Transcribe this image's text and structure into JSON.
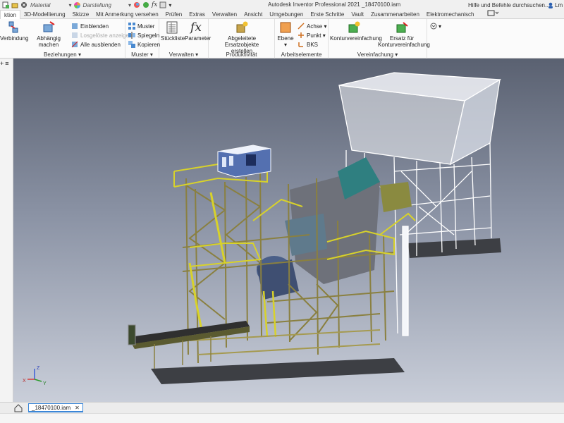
{
  "title_bar": {
    "app_title": "Autodesk Inventor Professional 2021   _18470100.iam",
    "material_combo": "Material",
    "appearance_combo": "Darstellung",
    "help_search": "Hilfe und Befehle durchsuchen...",
    "user_label": "Lm"
  },
  "ribbon_tabs": [
    "ktion",
    "3D-Modellierung",
    "Skizze",
    "Mit Anmerkung versehen",
    "Prüfen",
    "Extras",
    "Verwalten",
    "Ansicht",
    "Umgebungen",
    "Erste Schritte",
    "Vault",
    "Zusammenarbeiten",
    "Elektromechanisch"
  ],
  "ribbon": {
    "beziehungen": {
      "title": "Beziehungen",
      "verbindung": "Verbindung",
      "abhaengig": "Abhängig machen",
      "einblenden": "Einblenden",
      "losgeloeste": "Losgelöste anzeigen",
      "alle_ausblenden": "Alle ausblenden"
    },
    "muster": {
      "title": "Muster",
      "muster": "Muster",
      "spiegeln": "Spiegeln",
      "kopieren": "Kopieren"
    },
    "verwalten": {
      "title": "Verwalten",
      "stueckliste": "Stückliste",
      "parameter": "Parameter"
    },
    "produktivitaet": {
      "title": "Produktivität",
      "ersatz_line1": "Abgeleitete Ersatzobjekte",
      "ersatz_line2": "erstellen"
    },
    "arbeitselemente": {
      "title": "Arbeitselemente",
      "ebene": "Ebene",
      "achse": "Achse",
      "punkt": "Punkt",
      "bks": "BKS"
    },
    "vereinfachung": {
      "title": "Vereinfachung",
      "kontur": "Konturvereinfachung",
      "ersatz_fuer_line1": "Ersatz für",
      "ersatz_fuer_line2": "Konturvereinfachung"
    }
  },
  "document_tabs": [
    {
      "label": "_18470100.iam",
      "active": true
    }
  ],
  "view_cube_axes": {
    "x": "X",
    "y": "Y",
    "z": "Z"
  },
  "colors": {
    "structure_yellow": "#d8d22a",
    "structure_olive": "#8a8040",
    "bin_white": "#f4f6fa",
    "crusher_blue": "#4a5f88",
    "base_dark": "#3d3f44",
    "accent_blue": "#3a86d8"
  }
}
